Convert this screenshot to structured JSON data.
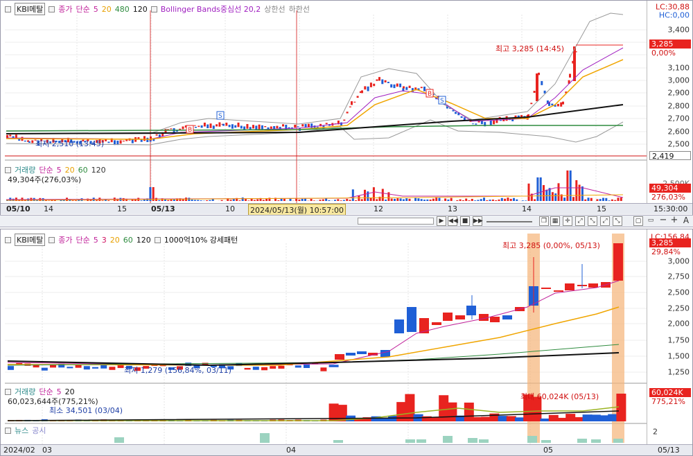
{
  "top_chart": {
    "stock_label": "KBI메탈",
    "legend": {
      "price": "종가",
      "ma_prefix": "단순",
      "ma": [
        "5",
        "20",
        "480",
        "120"
      ],
      "bb": "Bollinger Bands중심선 20,2",
      "upper": "상한선",
      "lower": "하한선"
    },
    "price_ticks": [
      "3,400",
      "3,300",
      "3,200",
      "3,100",
      "3,000",
      "2,900",
      "2,800",
      "2,700",
      "2,600",
      "2,500"
    ],
    "lc": "LC:30,88",
    "hc": "HC:0,00",
    "current_price": "3,285",
    "current_pct": "0,00%",
    "low_line_label": "2,419",
    "high_annotation": "최고 3,285 (14:45)",
    "low_annotation": "최저 2,510 (13:45)",
    "volume_legend": {
      "label": "거래량",
      "ma_prefix": "단순",
      "ma": [
        "5",
        "20",
        "60",
        "120"
      ]
    },
    "volume_value": "49,304주(276,03%)",
    "volume_tick": "2,500K",
    "volume_current": "49,304",
    "volume_pct": "276,03%",
    "date_labels": [
      "05/10",
      "14",
      "15",
      "05/13",
      "10",
      "11",
      "12",
      "13",
      "14",
      "15"
    ],
    "cursor_time": "2024/05/13(월) 10:57:00",
    "right_time": "15:30:00"
  },
  "bottom_chart": {
    "stock_label": "KBI메탈",
    "legend": {
      "price": "종가",
      "ma_prefix": "단순",
      "ma": [
        "5",
        "3",
        "20",
        "60",
        "120"
      ],
      "pattern": "1000억10% 강세패턴"
    },
    "price_ticks": [
      "3,000",
      "2,750",
      "2,500",
      "2,250",
      "2,000",
      "1,750",
      "1,500",
      "1,250"
    ],
    "lc": "LC:156,84",
    "current_price": "3,285",
    "current_pct": "29,84%",
    "high_annotation": "최고 3,285 (0,00%, 05/13)",
    "low_annotation": "최저 1,279 (156,84%, 03/11)",
    "volume_legend": {
      "label": "거래량",
      "ma_prefix": "단순",
      "ma": [
        "5",
        "20"
      ]
    },
    "volume_value": "60,023,644주(775,21%)",
    "volume_max": "최대 60,024K (05/13)",
    "volume_min": "최소 34,501 (03/04)",
    "volume_current": "60,024K",
    "volume_pct": "775,21%",
    "news_labels": [
      "뉴스",
      "공시"
    ],
    "news_tick": "2",
    "date_labels": [
      "2024/02",
      "03",
      "04",
      "05"
    ],
    "right_date": "05/13"
  },
  "toolbar": {
    "icons": [
      "play-icon",
      "rewind-icon",
      "stop-icon",
      "forward-icon",
      "zoom-slider",
      "cascade-icon",
      "grid-icon",
      "crosshair-icon",
      "zoom-in-icon",
      "zoom-out-icon",
      "box-icon",
      "minus-icon",
      "plus-icon"
    ],
    "text_button": "A"
  },
  "colors": {
    "up": "#e8231f",
    "down": "#1f5fd6",
    "ma5": "#c0219a",
    "ma20": "#f0a500",
    "ma60": "#2e8b3e",
    "ma120": "#111111",
    "bb": "#999999"
  }
}
